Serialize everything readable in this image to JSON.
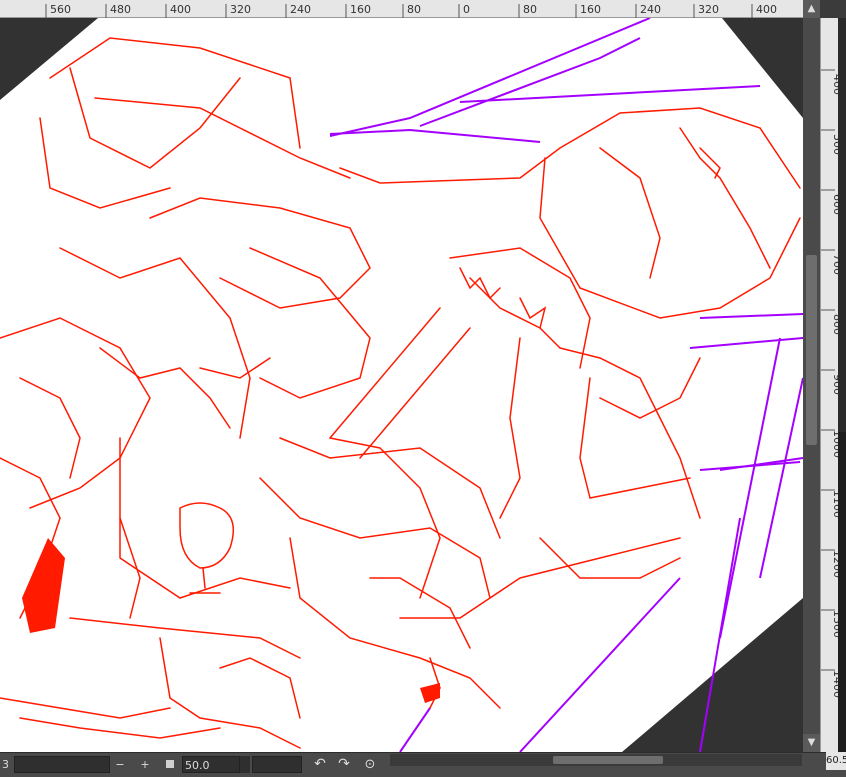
{
  "ruler": {
    "top_labels": [
      "560",
      "480",
      "400",
      "320",
      "240",
      "160",
      "80",
      "0",
      "80",
      "160",
      "240",
      "320",
      "400"
    ],
    "right_labels": [
      "400",
      "500",
      "600",
      "700",
      "800",
      "900",
      "1000",
      "1100",
      "1200",
      "1300",
      "1400"
    ]
  },
  "status": {
    "left_value": "3",
    "zoom_minus": "−",
    "zoom_plus": "+",
    "zoom_value": "50.0",
    "rotate_left_icon": "↶",
    "rotate_right_icon": "↷",
    "reset_rotation_icon": "⊙",
    "right_zoom_readout": "60.5"
  },
  "colors": {
    "sketch_red": "#ff1a00",
    "guide_purple": "#a400ff",
    "canvas_bg": "#323232",
    "paper": "#ffffff"
  }
}
